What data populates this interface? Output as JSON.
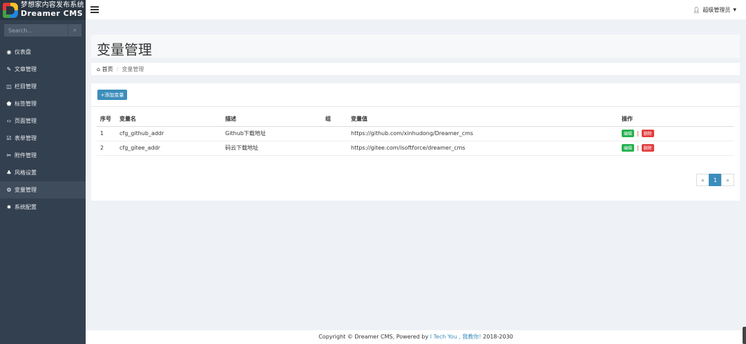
{
  "brand": {
    "title_cn": "梦想家内容发布系统",
    "title_en": "Dreamer CMS"
  },
  "search": {
    "placeholder": "Search..."
  },
  "sidebar": {
    "items": [
      {
        "label": "仪表盘",
        "icon": "dashboard-icon",
        "glyph": "◉"
      },
      {
        "label": "文章管理",
        "icon": "edit-icon",
        "glyph": "✎"
      },
      {
        "label": "栏目管理",
        "icon": "columns-icon",
        "glyph": "◫"
      },
      {
        "label": "标签管理",
        "icon": "tags-icon",
        "glyph": "⬟"
      },
      {
        "label": "页面管理",
        "icon": "code-icon",
        "glyph": "‹›"
      },
      {
        "label": "表单管理",
        "icon": "check-square-icon",
        "glyph": "☑"
      },
      {
        "label": "附件管理",
        "icon": "paperclip-icon",
        "glyph": "✂"
      },
      {
        "label": "风格设置",
        "icon": "puzzle-icon",
        "glyph": "♣"
      },
      {
        "label": "变量管理",
        "icon": "cogs-icon",
        "glyph": "⚙",
        "active": true
      },
      {
        "label": "系统配置",
        "icon": "gear-icon",
        "glyph": "✹"
      }
    ]
  },
  "header": {
    "user_label": "超级管理员"
  },
  "page": {
    "title": "变量管理"
  },
  "breadcrumb": {
    "home": "首页",
    "current": "变量管理"
  },
  "toolbar": {
    "add_label": "+添加变量"
  },
  "table": {
    "headers": [
      "序号",
      "变量名",
      "描述",
      "组",
      "变量值",
      "操作"
    ],
    "rows": [
      {
        "no": "1",
        "name": "cfg_github_addr",
        "desc": "Github下载地址",
        "group": "",
        "value": "https://github.com/xinhudong/Dreamer_cms"
      },
      {
        "no": "2",
        "name": "cfg_gitee_addr",
        "desc": "码云下载地址",
        "group": "",
        "value": "https://gitee.com/isoftforce/dreamer_cms"
      }
    ],
    "edit_label": "编辑",
    "delete_label": "删除",
    "action_separator": "|"
  },
  "pagination": {
    "prev": "«",
    "current": "1",
    "next": "»"
  },
  "footer": {
    "prefix": "Copyright © Dreamer CMS, Powered by ",
    "link": "I Tech You , 我教你!",
    "suffix": " 2018-2030"
  },
  "colors": {
    "sidebar": "#33404f",
    "accent": "#3c8dbc",
    "edit": "#23b14d",
    "delete": "#e23d3d"
  }
}
